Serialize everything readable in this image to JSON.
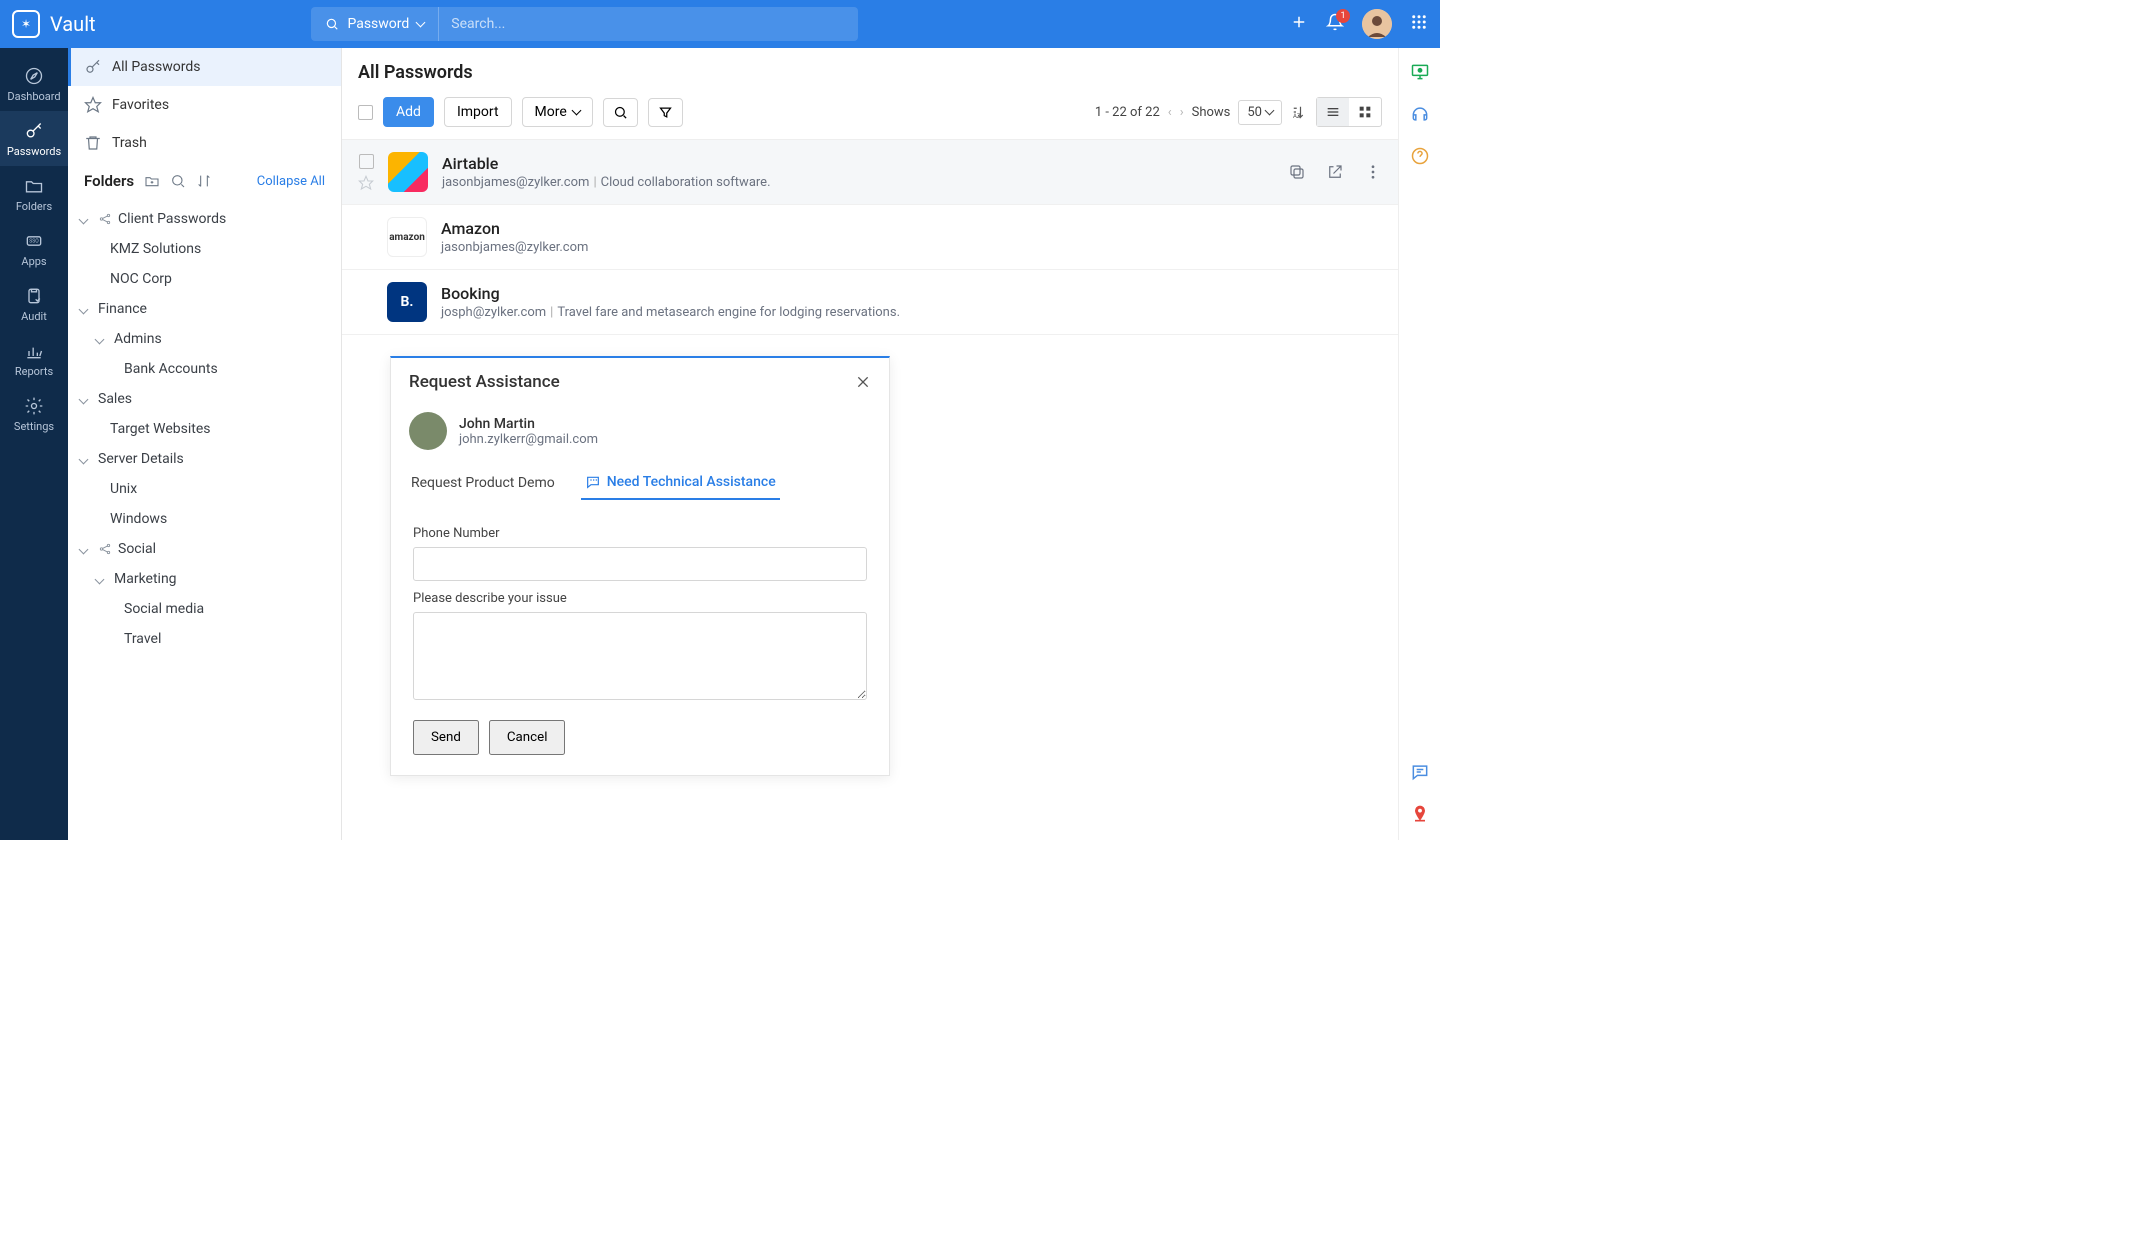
{
  "app": {
    "name": "Vault"
  },
  "topbar": {
    "search_scope": "Password",
    "search_placeholder": "Search...",
    "notif_count": "1"
  },
  "leftrail": [
    {
      "id": "dashboard",
      "label": "Dashboard"
    },
    {
      "id": "passwords",
      "label": "Passwords"
    },
    {
      "id": "folders",
      "label": "Folders"
    },
    {
      "id": "apps",
      "label": "Apps"
    },
    {
      "id": "audit",
      "label": "Audit"
    },
    {
      "id": "reports",
      "label": "Reports"
    },
    {
      "id": "settings",
      "label": "Settings"
    }
  ],
  "sidebar": {
    "all_passwords": "All Passwords",
    "favorites": "Favorites",
    "trash": "Trash",
    "folders_title": "Folders",
    "collapse": "Collapse All",
    "tree": {
      "client_passwords": "Client Passwords",
      "kmz": "KMZ Solutions",
      "noc": "NOC Corp",
      "finance": "Finance",
      "admins": "Admins",
      "bank": "Bank Accounts",
      "sales": "Sales",
      "target": "Target Websites",
      "server": "Server Details",
      "unix": "Unix",
      "windows": "Windows",
      "social": "Social",
      "marketing": "Marketing",
      "social_media": "Social media",
      "travel": "Travel"
    }
  },
  "main": {
    "title": "All Passwords",
    "add": "Add",
    "import": "Import",
    "more": "More",
    "range": "1 - 22 of 22",
    "shows": "Shows",
    "page_size": "50"
  },
  "rows": [
    {
      "title": "Airtable",
      "email": "jasonbjames@zylker.com",
      "desc": "Cloud collaboration software."
    },
    {
      "title": "Amazon",
      "email": "jasonbjames@zylker.com",
      "desc": ""
    },
    {
      "title": "Booking",
      "email": "josph@zylker.com",
      "desc": "Travel fare and metasearch engine for lodging reservations."
    }
  ],
  "dialog": {
    "title": "Request Assistance",
    "user_name": "John Martin",
    "user_email": "john.zylkerr@gmail.com",
    "tab_demo": "Request Product Demo",
    "tab_tech": "Need Technical Assistance",
    "label_phone": "Phone Number",
    "label_issue": "Please describe your issue",
    "send": "Send",
    "cancel": "Cancel"
  }
}
